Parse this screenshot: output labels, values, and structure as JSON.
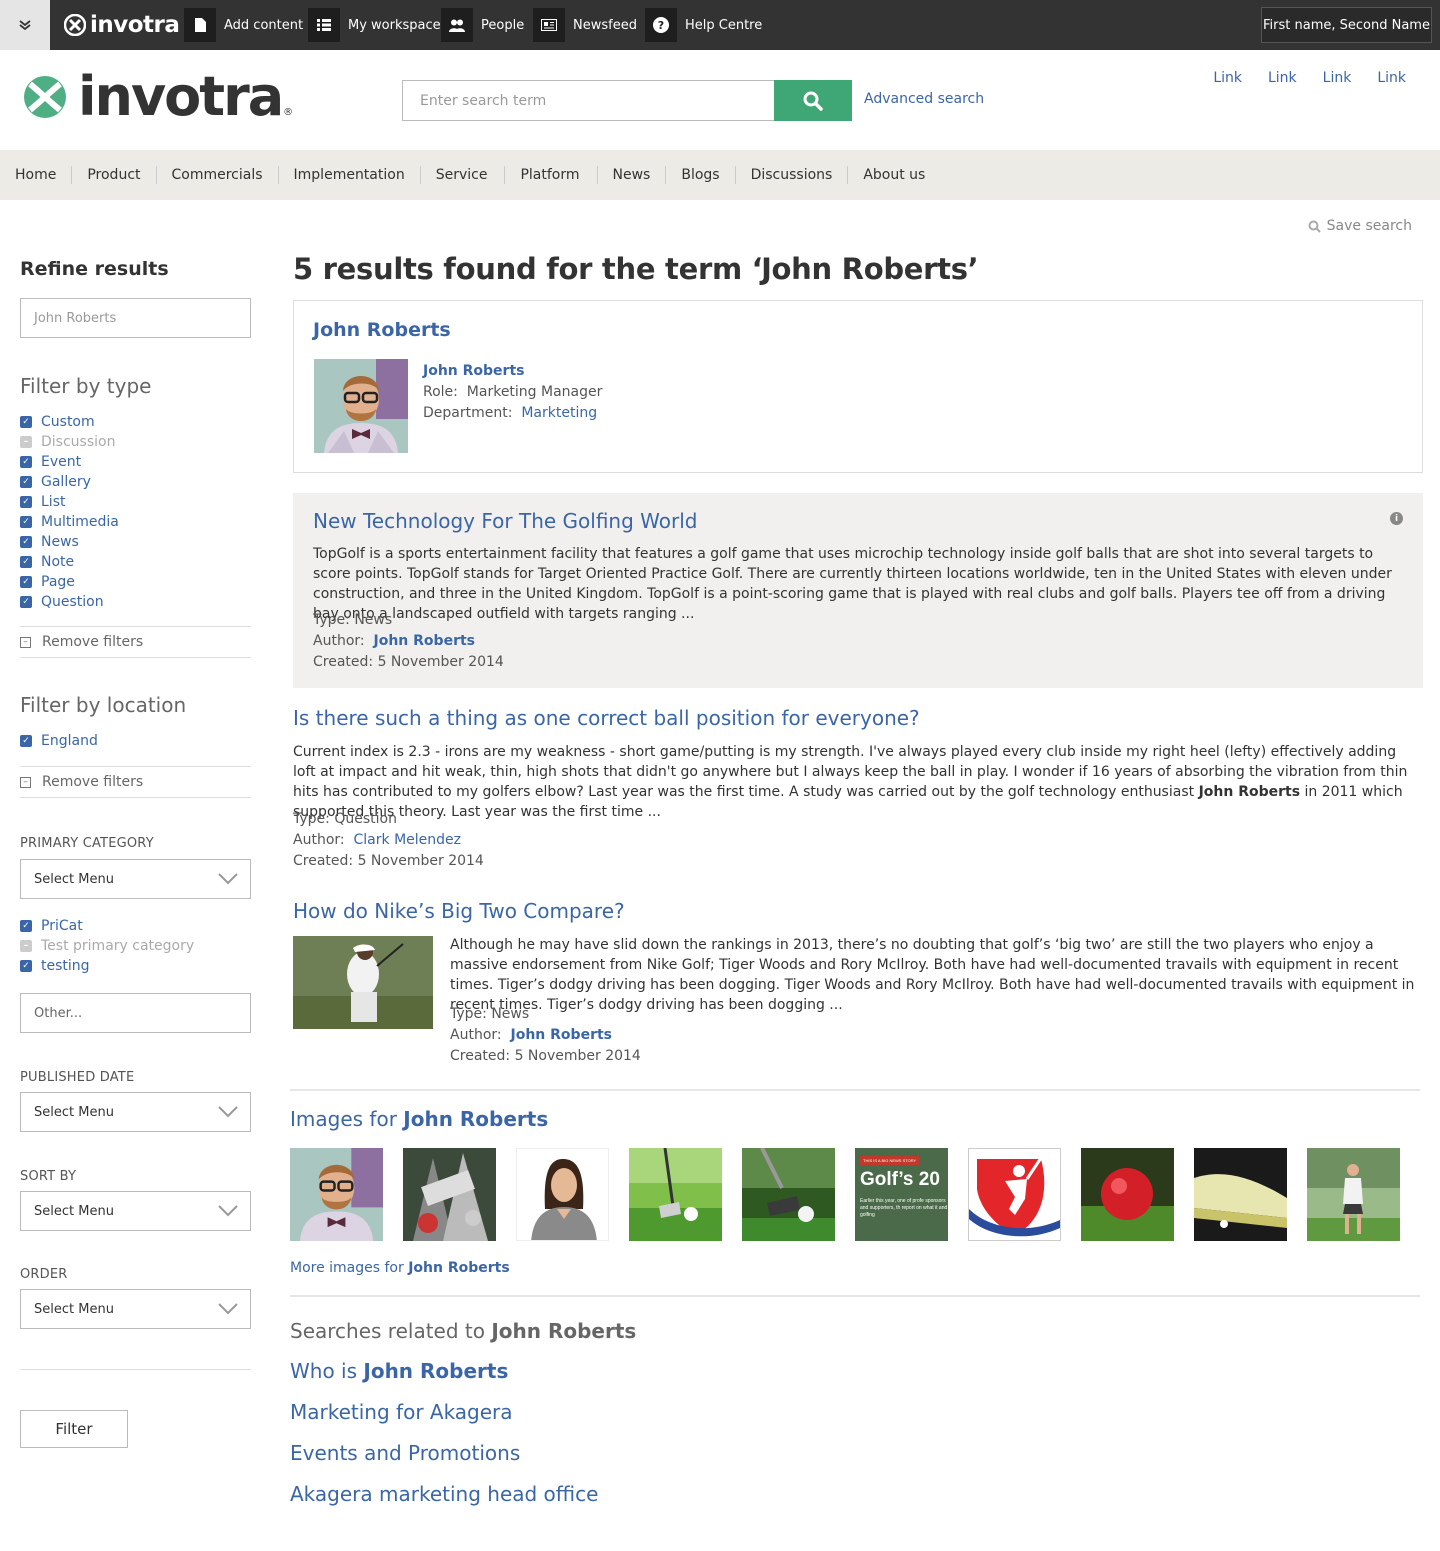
{
  "topbar": {
    "brand": "invotra",
    "items": [
      {
        "label": "Add content",
        "icon": "document-icon"
      },
      {
        "label": "My workspace",
        "icon": "list-icon"
      },
      {
        "label": "People",
        "icon": "people-icon"
      },
      {
        "label": "Newsfeed",
        "icon": "newspaper-icon"
      },
      {
        "label": "Help Centre",
        "icon": "help-icon"
      }
    ],
    "user_name": "First name, Second Name"
  },
  "header": {
    "logo_text": "invotra",
    "logo_reg": "®",
    "search_placeholder": "Enter search term",
    "advanced_search": "Advanced search",
    "links": [
      "Link",
      "Link",
      "Link",
      "Link"
    ]
  },
  "nav": [
    "Home",
    "Product",
    "Commercials",
    "Implementation",
    "Service",
    "Platform",
    "News",
    "Blogs",
    "Discussions",
    "About us"
  ],
  "save_search": "Save search",
  "sidebar": {
    "refine_title": "Refine results",
    "refine_value": "John Roberts",
    "filter_type_title": "Filter by type",
    "types": [
      {
        "label": "Custom",
        "checked": true
      },
      {
        "label": "Discussion",
        "checked": false
      },
      {
        "label": "Event",
        "checked": true
      },
      {
        "label": "Gallery",
        "checked": true
      },
      {
        "label": "List",
        "checked": true
      },
      {
        "label": "Multimedia",
        "checked": true
      },
      {
        "label": "News",
        "checked": true
      },
      {
        "label": "Note",
        "checked": true
      },
      {
        "label": "Page",
        "checked": true
      },
      {
        "label": "Question",
        "checked": true
      }
    ],
    "remove_filters": "Remove filters",
    "filter_location_title": "Filter by location",
    "location": "England",
    "primary_category_label": "PRIMARY CATEGORY",
    "select_menu": "Select Menu",
    "categories": [
      {
        "label": "PriCat",
        "checked": true
      },
      {
        "label": "Test primary category",
        "checked": false
      },
      {
        "label": "testing",
        "checked": true
      }
    ],
    "other_placeholder": "Other...",
    "published_date_label": "PUBLISHED DATE",
    "sort_by_label": "SORT BY",
    "order_label": "ORDER",
    "filter_button": "Filter"
  },
  "results": {
    "heading": "5 results found for the term ‘John Roberts’",
    "person_card": {
      "title": "John Roberts",
      "name": "John Roberts",
      "role_label": "Role:",
      "role": "Marketing Manager",
      "dept_label": "Department:",
      "dept": "Markteting"
    },
    "items": [
      {
        "title": "New Technology For The Golfing World",
        "body": "TopGolf is a sports entertainment facility that features a golf game that uses microchip technology inside golf balls that are shot into several targets to score points. TopGolf stands for Target Oriented Practice Golf. There are currently thirteen locations worldwide, ten in the United States with eleven under construction, and three in the United Kingdom. TopGolf is a point-scoring game that is played with real clubs and golf balls. Players tee off from a driving bay onto a landscaped outfield with targets ranging ...",
        "type": "Type: News",
        "author_label": "Author:",
        "author": "John Roberts",
        "created": "Created: 5 November 2014"
      },
      {
        "title": "Is there such a thing as one correct ball position for everyone?",
        "body_pre": "Current index is 2.3 - irons are my weakness - short game/putting is my strength. I've always played every club inside my right heel (lefty) effectively adding loft at impact and hit weak, thin, high shots that didn't go anywhere but I always keep the ball in play.  I wonder if 16 years of absorbing the vibration from thin hits has contributed to my golfers elbow? Last year was the first time.  A study was carried out by the golf technology enthusiast ",
        "body_bold": "John Roberts",
        "body_post": " in 2011 which supported this theory.  Last year was the first time ...",
        "type": "Type: Question",
        "author_label": "Author:",
        "author": "Clark Melendez",
        "created": "Created: 5 November 2014"
      },
      {
        "title": "How do Nike’s Big Two Compare?",
        "body": "Although he may have slid down the rankings in 2013, there’s no doubting that golf’s ‘big two’  are still the two players who enjoy a massive endorsement from Nike Golf; Tiger Woods and Rory McIlroy. Both have had well-documented travails with equipment in recent times. Tiger’s dodgy driving has been dogging. Tiger Woods and Rory McIlroy. Both have had well-documented travails with equipment in recent times. Tiger’s dodgy driving has been dogging ...",
        "type": "Type: News",
        "author_label": "Author:",
        "author": "John Roberts",
        "created": "Created: 5 November 2014"
      }
    ],
    "images_heading_pre": "Images for ",
    "images_heading_name": "John Roberts",
    "news_thumb_tag": "THIS IS A BIG NEWS STORY",
    "news_thumb_title": "Golf’s 20",
    "news_thumb_text": "Earlier this year, one of profe sponsors and supporters, th report on what it and golfing",
    "more_images_pre": "More images for ",
    "more_images_name": "John Roberts",
    "related_heading_pre": "Searches related to ",
    "related_heading_name": "John Roberts",
    "related": [
      {
        "pre": "Who is ",
        "bold": "John Roberts"
      },
      {
        "pre": "Marketing for Akagera",
        "bold": ""
      },
      {
        "pre": "Events and Promotions",
        "bold": ""
      },
      {
        "pre": "Akagera marketing head office",
        "bold": ""
      }
    ]
  },
  "colors": {
    "accent": "#3fa676",
    "link": "#3a66a8",
    "topbar": "#333333",
    "nav_bg": "#ecebe6"
  }
}
